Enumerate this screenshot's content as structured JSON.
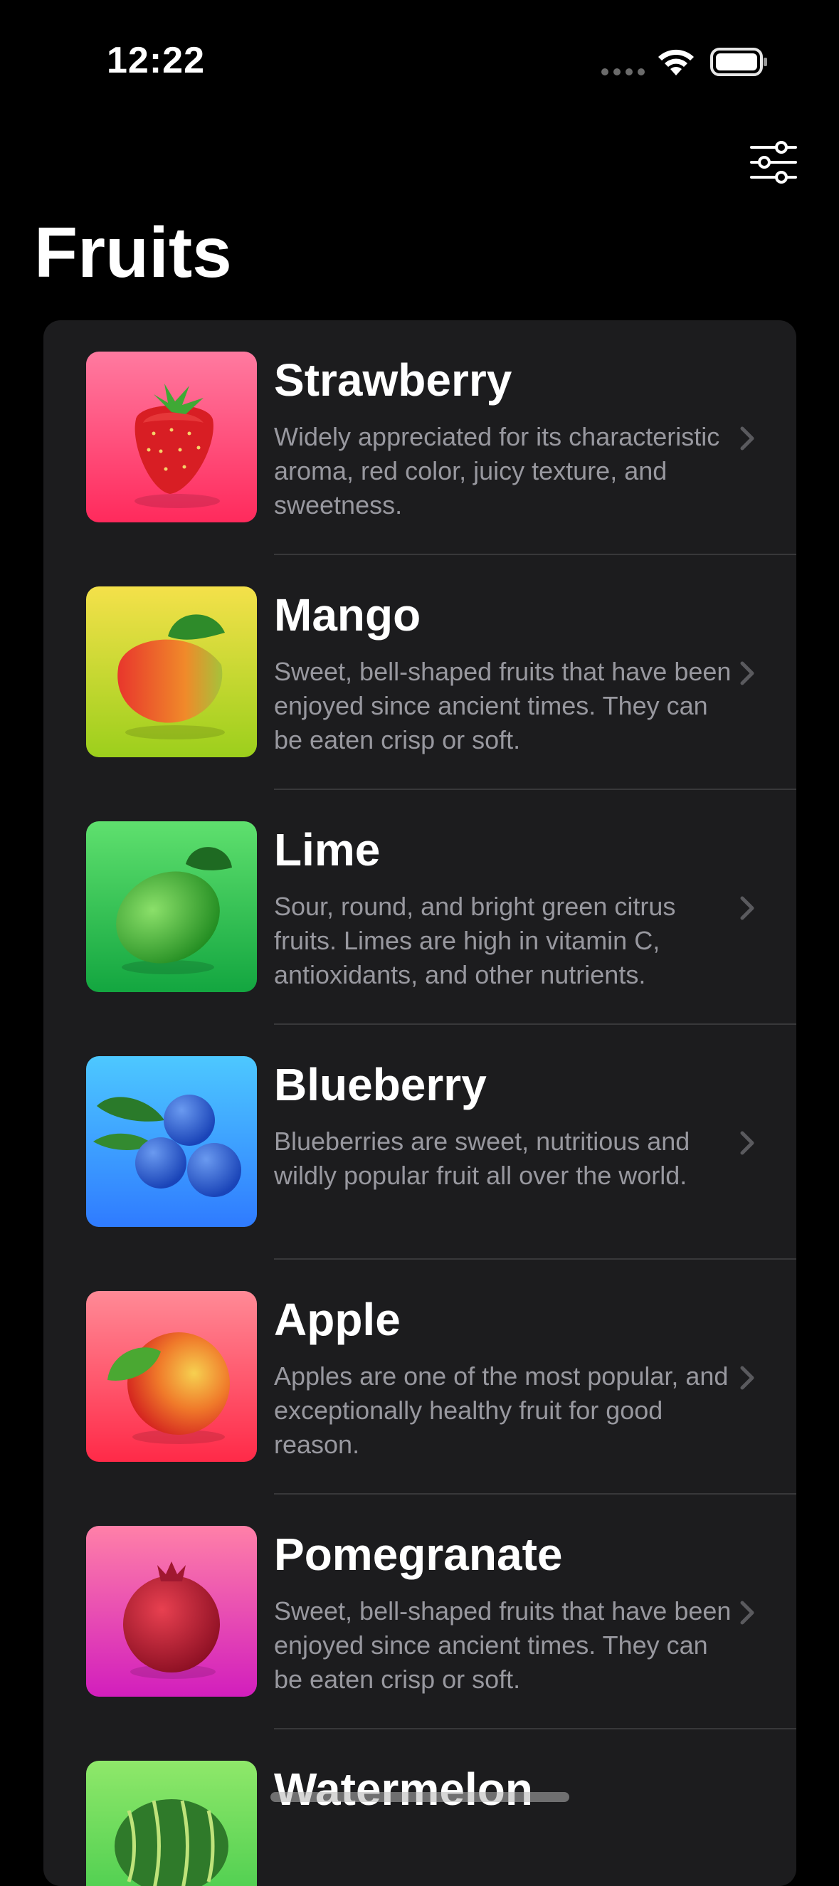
{
  "status_bar": {
    "time": "12:22",
    "wifi_icon": "wifi-icon",
    "battery_icon": "battery-icon"
  },
  "toolbar": {
    "filter_icon": "sliders-icon"
  },
  "page": {
    "title": "Fruits"
  },
  "fruits": [
    {
      "name": "Strawberry",
      "description": "Widely appreciated for its characteristic aroma,  red color, juicy texture, and sweetness.",
      "gradient": [
        "#ff7aa0",
        "#ff2a5c"
      ],
      "fruit_color": "#d81e24",
      "icon": "strawberry-icon"
    },
    {
      "name": "Mango",
      "description": "Sweet, bell-shaped fruits that have been enjoyed since ancient times. They can be eaten crisp or soft.",
      "gradient": [
        "#f4e14a",
        "#9ccf1c"
      ],
      "fruit_color": "#e8362c",
      "icon": "mango-icon"
    },
    {
      "name": "Lime",
      "description": "Sour, round, and bright green citrus fruits. Limes are high in vitamin C, antioxidants, and other nutrients.",
      "gradient": [
        "#5fe06e",
        "#13a640"
      ],
      "fruit_color": "#2fa82a",
      "icon": "lime-icon"
    },
    {
      "name": "Blueberry",
      "description": "Blueberries are sweet, nutritious and wildly popular fruit all over the world.",
      "gradient": [
        "#4dc8ff",
        "#2f7bff"
      ],
      "fruit_color": "#2a5fd6",
      "icon": "blueberry-icon"
    },
    {
      "name": "Apple",
      "description": "Apples are one of the most popular, and exceptionally healthy fruit for good reason.",
      "gradient": [
        "#ff8a96",
        "#ff2a48"
      ],
      "fruit_color": "#e32a2a",
      "icon": "apple-icon"
    },
    {
      "name": "Pomegranate",
      "description": "Sweet, bell-shaped fruits that have been enjoyed since ancient times. They can be eaten crisp or soft.",
      "gradient": [
        "#ff80a8",
        "#d21ebd"
      ],
      "fruit_color": "#b3142c",
      "icon": "pomegranate-icon"
    },
    {
      "name": "Watermelon",
      "description": "",
      "gradient": [
        "#8fe86a",
        "#3ec84a"
      ],
      "fruit_color": "#2f7a2a",
      "icon": "watermelon-icon"
    }
  ]
}
